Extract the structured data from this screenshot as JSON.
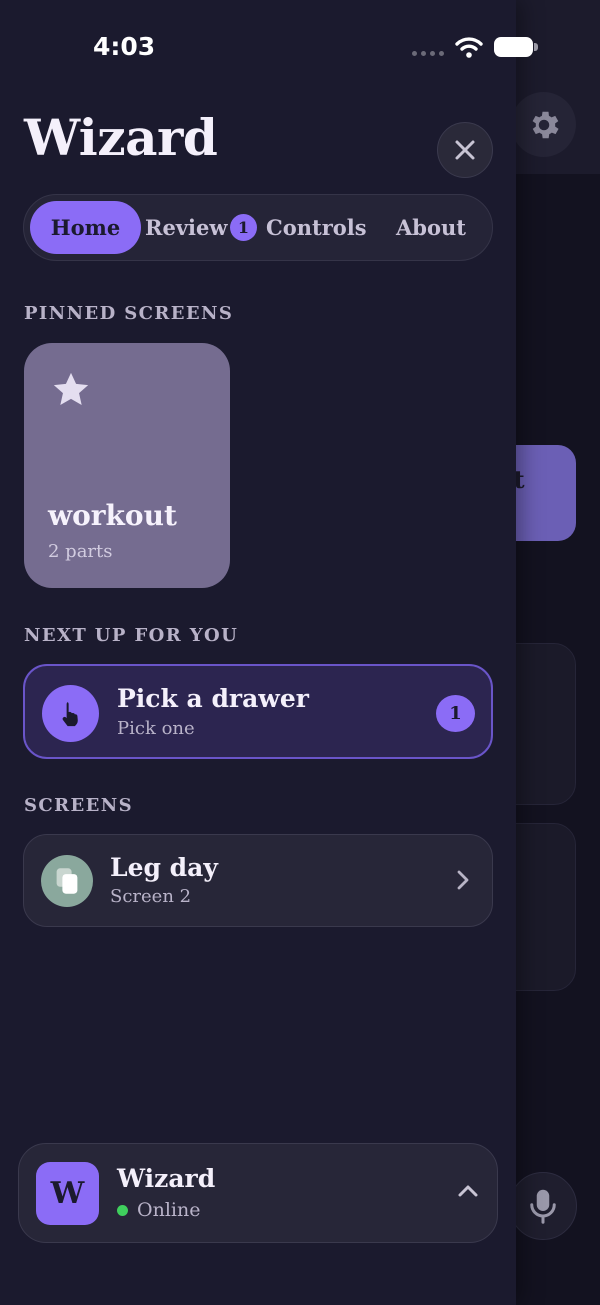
{
  "status_bar": {
    "time": "4:03"
  },
  "background": {
    "card_text": "out"
  },
  "drawer": {
    "title": "Wizard",
    "tabs": [
      {
        "label": "Home",
        "active": true
      },
      {
        "label": "Review",
        "badge": "1"
      },
      {
        "label": "Controls"
      },
      {
        "label": "About"
      }
    ],
    "pinned": {
      "heading": "PINNED SCREENS",
      "items": [
        {
          "name": "workout",
          "parts": "2 parts",
          "icon": "star-icon"
        }
      ]
    },
    "next_up": {
      "heading": "NEXT UP FOR YOU",
      "items": [
        {
          "title": "Pick a drawer",
          "subtitle": "Pick one",
          "badge": "1",
          "icon": "pointing-hand-icon"
        }
      ]
    },
    "screens": {
      "heading": "SCREENS",
      "items": [
        {
          "title": "Leg day",
          "subtitle": "Screen 2",
          "icon": "copy-icon"
        }
      ]
    },
    "footer": {
      "logo_letter": "W",
      "app_name": "Wizard",
      "status": "Online"
    }
  },
  "colors": {
    "accent": "#8b6cf6",
    "drawer_bg": "#1b1a2e",
    "online": "#3fcf5d",
    "pinned_card": "#756c90"
  }
}
